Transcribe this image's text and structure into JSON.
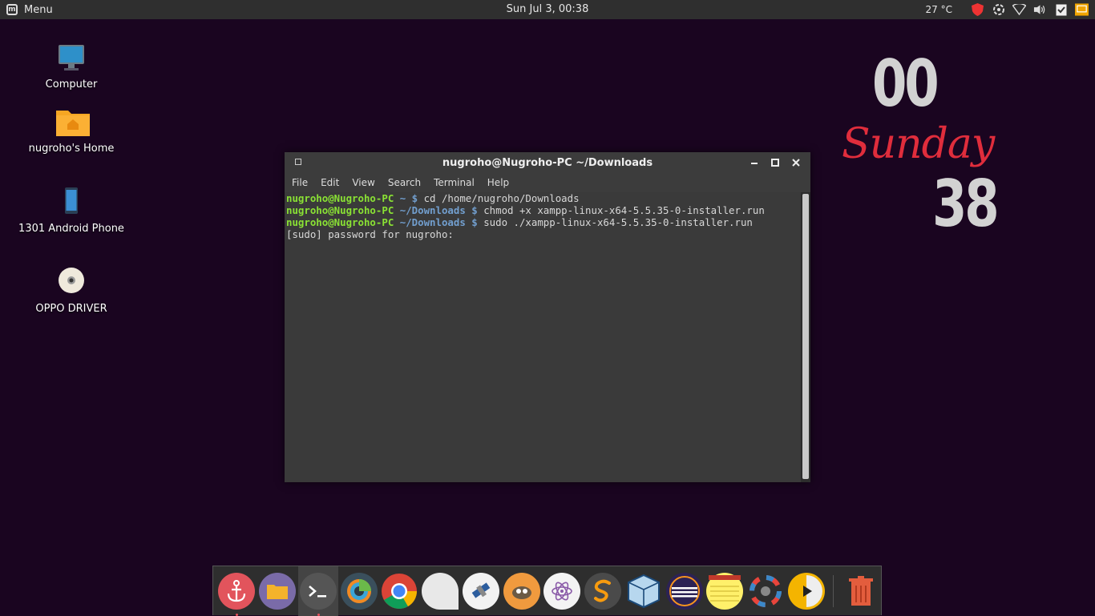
{
  "panel": {
    "menu_label": "Menu",
    "datetime": "Sun Jul  3, 00:38",
    "temperature": "27 °C",
    "tray_icons": [
      "shield-icon",
      "spinner-icon",
      "wifi-icon",
      "volume-icon",
      "checklist-icon",
      "screen-icon"
    ]
  },
  "desktop": {
    "icons": [
      {
        "label": "Computer"
      },
      {
        "label": "nugroho's Home"
      },
      {
        "label": "1301 Android Phone"
      },
      {
        "label": "OPPO DRIVER"
      }
    ]
  },
  "clock_widget": {
    "hour": "00",
    "day": "Sunday",
    "minute": "38",
    "day_color": "#e02d3c"
  },
  "terminal": {
    "title": "nugroho@Nugroho-PC ~/Downloads",
    "menu": [
      "File",
      "Edit",
      "View",
      "Search",
      "Terminal",
      "Help"
    ],
    "lines": [
      {
        "user": "nugroho@Nugroho-PC",
        "path": " ~",
        "prompt": " $ ",
        "cmd": "cd /home/nugroho/Downloads"
      },
      {
        "user": "nugroho@Nugroho-PC",
        "path": " ~/Downloads",
        "prompt": " $ ",
        "cmd": "chmod +x xampp-linux-x64-5.5.35-0-installer.run"
      },
      {
        "user": "nugroho@Nugroho-PC",
        "path": " ~/Downloads",
        "prompt": " $ ",
        "cmd": "sudo ./xampp-linux-x64-5.5.35-0-installer.run"
      }
    ],
    "output": "[sudo] password for nugroho:"
  },
  "dock": {
    "items": [
      "anchor-icon",
      "files-icon",
      "terminal-icon",
      "disk-usage-icon",
      "chrome-icon",
      "shape-icon",
      "satellite-icon",
      "gimp-icon",
      "atom-icon",
      "sublime-icon",
      "virtualbox-icon",
      "eclipse-icon",
      "notes-icon",
      "settings-wheel-icon",
      "media-player-icon",
      "trash-icon"
    ]
  }
}
